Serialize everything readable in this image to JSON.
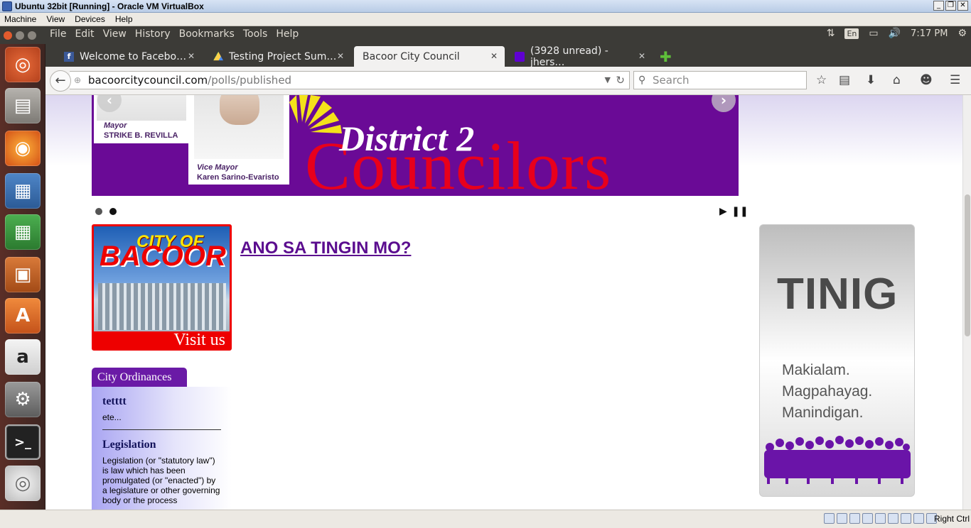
{
  "vbox": {
    "title": "Ubuntu 32bit [Running] - Oracle VM VirtualBox",
    "menu": [
      "Machine",
      "View",
      "Devices",
      "Help"
    ],
    "host_key": "Right Ctrl"
  },
  "panel": {
    "menus": [
      "File",
      "Edit",
      "View",
      "History",
      "Bookmarks",
      "Tools",
      "Help"
    ],
    "keyboard": "En",
    "clock": "7:17 PM"
  },
  "launcher": {
    "items": [
      "ubuntu-dash",
      "files",
      "firefox",
      "writer",
      "calc",
      "impress",
      "software-center",
      "amazon",
      "system-settings",
      "terminal",
      "dvd"
    ]
  },
  "tabs": [
    {
      "label": "Welcome to Facebo…",
      "icon": "facebook-icon"
    },
    {
      "label": "Testing Project Sum…",
      "icon": "google-drive-icon"
    },
    {
      "label": "Bacoor City Council",
      "icon": "",
      "active": true
    },
    {
      "label": "(3928 unread) - jhers…",
      "icon": "yahoo-mail-icon"
    }
  ],
  "urlbar": {
    "host": "bacoorcitycouncil.com",
    "path": "/polls/published"
  },
  "search": {
    "placeholder": "Search"
  },
  "banner": {
    "mayor_role": "Mayor",
    "mayor_name": "STRIKE B. REVILLA",
    "vice_role": "Vice Mayor",
    "vice_name": "Karen Sarino-Evaristo",
    "district": "District 2",
    "councilors": "Councilors"
  },
  "visit": {
    "city_of": "CITY OF",
    "bacoor": "BACOOR",
    "visit_us": "Visit us"
  },
  "poll": {
    "title": "ANO SA TINGIN MO?"
  },
  "ordinances": {
    "tab": "City Ordinances",
    "items": [
      {
        "title": "tetttt",
        "text": "ete..."
      },
      {
        "title": "Legislation",
        "text": "Legislation (or \"statutory law\") is law which has been promulgated (or \"enacted\") by a legislature or other governing body or the process"
      }
    ]
  },
  "tinig": {
    "title": "TINIG",
    "line1": "Makialam.",
    "line2": "Magpahayag.",
    "line3": "Manindigan."
  },
  "colors": {
    "banner_purple": "#6a0a96",
    "councilors_red": "#e8001c",
    "poll_link": "#5b0d8f"
  }
}
